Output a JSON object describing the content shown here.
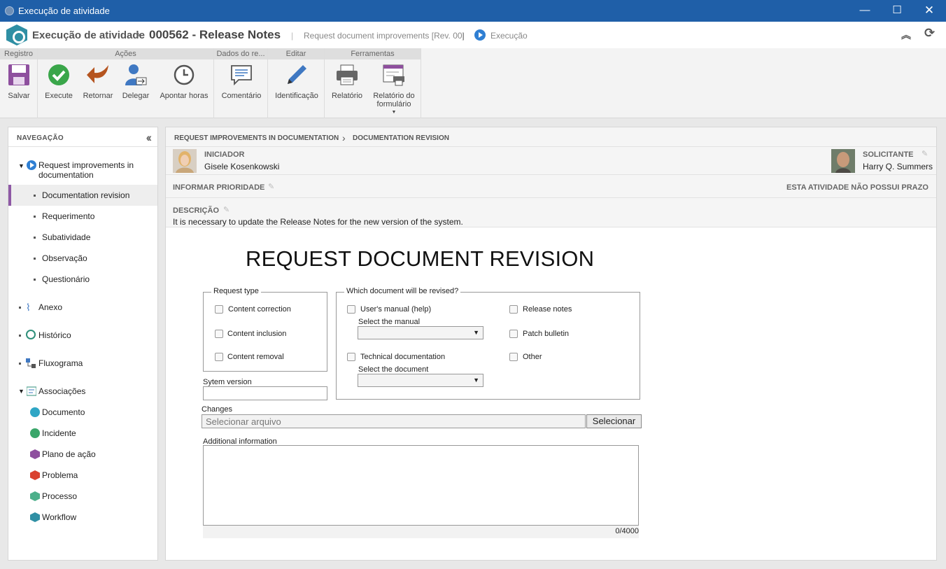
{
  "window": {
    "title": "Execução de atividade"
  },
  "header": {
    "app": "Execução de atividade",
    "record": "000562 - Release Notes",
    "process": "Request document improvements [Rev. 00]",
    "status": "Execução"
  },
  "ribbon": {
    "groups": [
      "Registro",
      "Ações",
      "Dados do re...",
      "Editar",
      "Ferramentas"
    ],
    "buttons": {
      "save": "Salvar",
      "execute": "Execute",
      "return": "Retornar",
      "delegate": "Delegar",
      "hours": "Apontar horas",
      "comment": "Comentário",
      "identification": "Identificação",
      "report": "Relatório",
      "form_report_1": "Relatório do",
      "form_report_2": "formulário"
    }
  },
  "nav": {
    "title": "NAVEGAÇÃO",
    "root_1": "Request improvements in",
    "root_2": "documentation",
    "sub": [
      "Documentation revision",
      "Requerimento",
      "Subatividade",
      "Observação",
      "Questionário"
    ],
    "items": [
      "Anexo",
      "Histórico",
      "Fluxograma",
      "Associações"
    ],
    "assoc": [
      "Documento",
      "Incidente",
      "Plano de ação",
      "Problema",
      "Processo",
      "Workflow"
    ]
  },
  "breadcrumb": {
    "a": "REQUEST IMPROVEMENTS IN DOCUMENTATION",
    "b": "DOCUMENTATION REVISION"
  },
  "people": {
    "initiator_label": "INICIADOR",
    "initiator": "Gisele Kosenkowski",
    "requester_label": "SOLICITANTE",
    "requester": "Harry Q. Summers"
  },
  "priority": {
    "label": "INFORMAR PRIORIDADE",
    "deadline": "ESTA ATIVIDADE NÃO POSSUI PRAZO"
  },
  "description": {
    "label": "DESCRIÇÃO",
    "text": "It is necessary to update the Release Notes for the new version of the system."
  },
  "form": {
    "title": "REQUEST DOCUMENT REVISION",
    "request_type": {
      "legend": "Request type",
      "options": [
        "Content correction",
        "Content inclusion",
        "Content removal"
      ]
    },
    "which_doc": {
      "legend": "Which document will be revised?",
      "users_manual": "User's manual (help)",
      "select_manual": "Select the manual",
      "technical": "Technical documentation",
      "select_document": "Select the document",
      "release_notes": "Release notes",
      "patch_bulletin": "Patch bulletin",
      "other": "Other"
    },
    "system_version": "Sytem version",
    "changes": "Changes",
    "file_placeholder": "Selecionar arquivo",
    "file_button": "Selecionar",
    "additional": "Additional information",
    "counter": "0/4000"
  }
}
